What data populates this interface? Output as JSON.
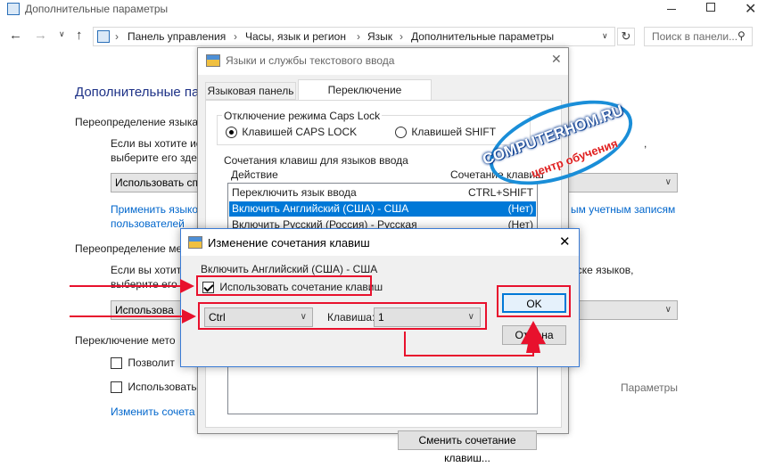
{
  "main_window": {
    "title": "Дополнительные параметры",
    "breadcrumb": [
      "Панель управления",
      "Часы, язык и регион",
      "Язык",
      "Дополнительные параметры"
    ],
    "search_placeholder": "Поиск в панели...",
    "heading": "Дополнительные па",
    "section1_title": "Переопределение языка",
    "section1_text_line1": "Если вы хотите ис",
    "section1_text_line2": "выберите его здес",
    "section1_text_right": ",",
    "section1_dropdown": "Использовать сп",
    "section1_link_line1": "Применить языко",
    "section1_link_line2": "пользователей",
    "section1_link_right": "ым учетным записям",
    "section2_title": "Переопределение ме",
    "section2_text_line1": "Если вы хотите",
    "section2_text_line2": "выберите его",
    "section2_text_right": "иске языков,",
    "section2_dropdown": "Использова",
    "section3_title": "Переключение мето",
    "check1_label": "Позволит",
    "check2_label": "Использовать",
    "params_link": "Параметры",
    "change_link": "Изменить сочета"
  },
  "text_services_dialog": {
    "title": "Языки и службы текстового ввода",
    "tabs": [
      "Языковая панель",
      "Переключение клавиатуры"
    ],
    "capslock_group": "Отключение режима Caps Lock",
    "radio1": "Клавишей CAPS LOCK",
    "radio2": "Клавишей SHIFT",
    "hotkeys_group": "Сочетания клавиш для языков ввода",
    "col_action": "Действие",
    "col_keys": "Сочетание клавиш",
    "rows": [
      {
        "action": "Переключить язык ввода",
        "keys": "CTRL+SHIFT"
      },
      {
        "action": "Включить Английский (США) - США",
        "keys": "(Нет)"
      },
      {
        "action": "Включить Русский (Россия) - Русская",
        "keys": "(Нет)"
      }
    ],
    "change_button": "Сменить сочетание клавиш..."
  },
  "hotkey_dialog": {
    "title": "Изменение сочетания клавиш",
    "subtitle": "Включить Английский (США) - США",
    "checkbox_label": "Использовать сочетание клавиш",
    "checkbox_checked": true,
    "modifier_value": "Ctrl",
    "key_label": "Клавиша:",
    "key_value": "1",
    "ok_label": "OK",
    "cancel_label": "Отмена"
  },
  "watermark": {
    "line1": "COMPUTERHOM.RU",
    "line2": "центр обучения"
  },
  "colors": {
    "annotation_red": "#e8112d",
    "selection_blue": "#0078d7",
    "link_blue": "#0066cc"
  }
}
